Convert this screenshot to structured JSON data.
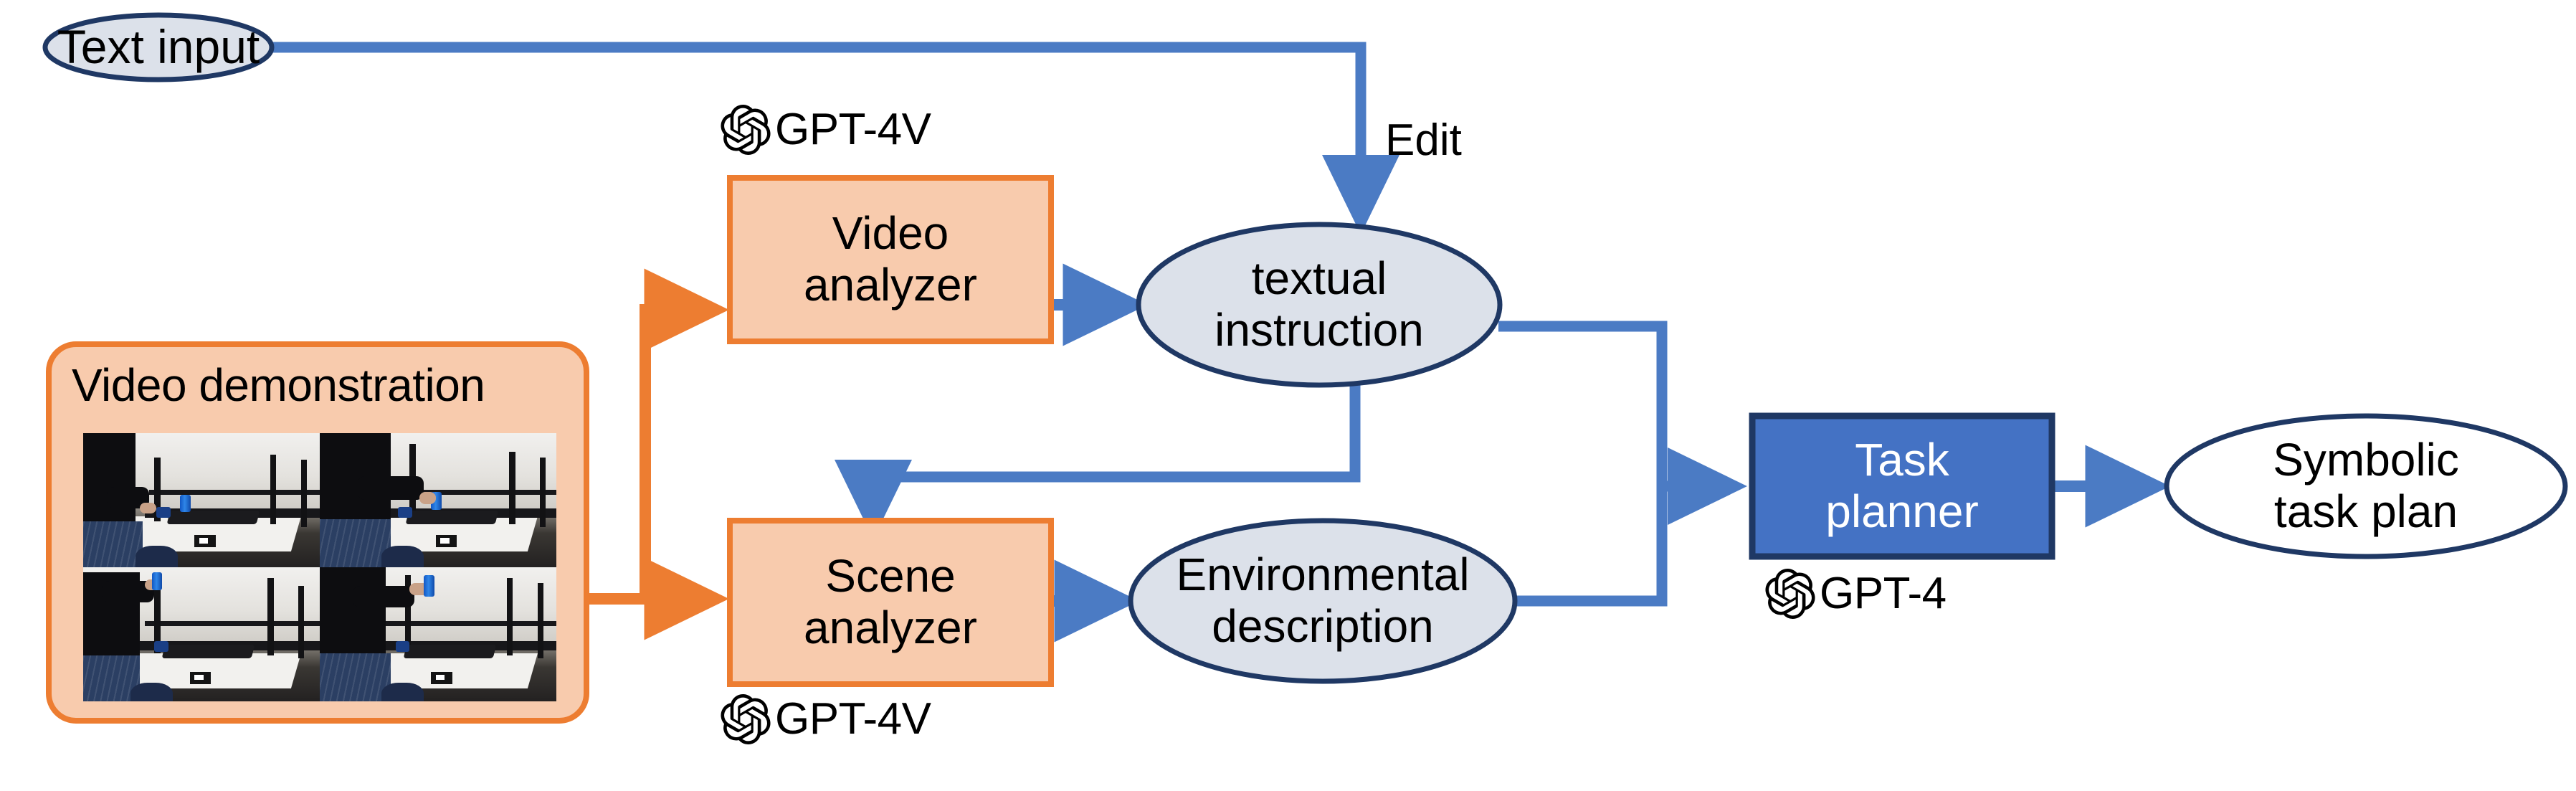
{
  "diagram": {
    "title": "GPT-4V / GPT-4 video-to-task-plan pipeline",
    "colors": {
      "ellipse_fill": "#dce1ea",
      "ellipse_stroke": "#1f3864",
      "process_fill": "#f8cbad",
      "process_stroke": "#ed7d31",
      "planner_fill": "#4472c4",
      "planner_stroke": "#1f3864",
      "output_fill": "#ffffff",
      "blue_arrow": "#4b7bc4",
      "orange_arrow": "#ed7d31",
      "text": "#000000",
      "planner_text": "#ffffff"
    }
  },
  "nodes": {
    "text_input": {
      "label": "Text input",
      "shape": "ellipse"
    },
    "video_demonstration": {
      "label": "Video demonstration",
      "shape": "rounded-rect"
    },
    "video_analyzer": {
      "label": "Video\nanalyzer",
      "shape": "rect"
    },
    "scene_analyzer": {
      "label": "Scene\nanalyzer",
      "shape": "rect"
    },
    "textual_instruction": {
      "label": "textual\ninstruction",
      "shape": "ellipse"
    },
    "environmental_description": {
      "label": "Environmental\ndescription",
      "shape": "ellipse"
    },
    "task_planner": {
      "label": "Task\nplanner",
      "shape": "rect"
    },
    "symbolic_task_plan": {
      "label": "Symbolic\ntask plan",
      "shape": "ellipse"
    }
  },
  "model_tags": {
    "video_analyzer_model": {
      "icon": "openai-logo-icon",
      "label": "GPT-4V"
    },
    "scene_analyzer_model": {
      "icon": "openai-logo-icon",
      "label": "GPT-4V"
    },
    "task_planner_model": {
      "icon": "openai-logo-icon",
      "label": "GPT-4"
    }
  },
  "edge_labels": {
    "edit": "Edit"
  },
  "edges": [
    {
      "from": "text_input",
      "to": "textual_instruction",
      "label": "Edit",
      "color": "blue"
    },
    {
      "from": "video_demonstration",
      "to": "video_analyzer",
      "label": "",
      "color": "orange"
    },
    {
      "from": "video_demonstration",
      "to": "scene_analyzer",
      "label": "",
      "color": "orange"
    },
    {
      "from": "video_analyzer",
      "to": "textual_instruction",
      "label": "",
      "color": "blue"
    },
    {
      "from": "textual_instruction",
      "to": "scene_analyzer",
      "label": "",
      "color": "blue"
    },
    {
      "from": "scene_analyzer",
      "to": "environmental_description",
      "label": "",
      "color": "blue"
    },
    {
      "from": "textual_instruction",
      "to": "task_planner",
      "label": "",
      "color": "blue"
    },
    {
      "from": "environmental_description",
      "to": "task_planner",
      "label": "",
      "color": "blue"
    },
    {
      "from": "task_planner",
      "to": "symbolic_task_plan",
      "label": "",
      "color": "blue"
    }
  ],
  "video_frames": [
    {
      "caption": ""
    },
    {
      "caption": ""
    },
    {
      "caption": ""
    },
    {
      "caption": ""
    }
  ]
}
